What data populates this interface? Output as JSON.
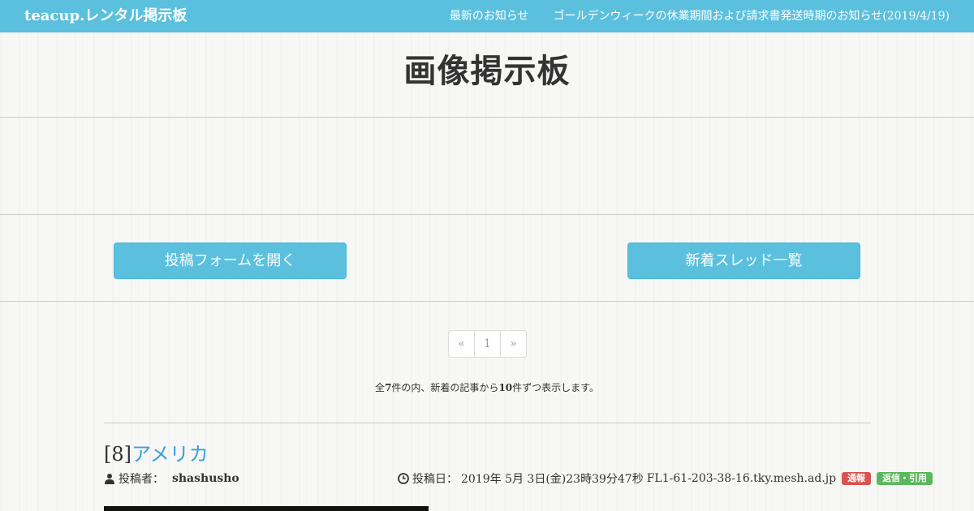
{
  "nav": {
    "brand": "teacup.レンタル掲示板",
    "links": [
      "最新のお知らせ",
      "ゴールデンウィークの休業期間および請求書発送時期のお知らせ(2019/4/19)"
    ]
  },
  "page_title": "画像掲示板",
  "buttons": {
    "open_form": "投稿フォームを開く",
    "new_threads": "新着スレッド一覧"
  },
  "pagination": {
    "prev": "«",
    "current": "1",
    "next": "»"
  },
  "summary": {
    "prefix": "全",
    "total": "7",
    "middle": "件の内、新着の記事から",
    "per_page": "10",
    "suffix": "件ずつ表示します。"
  },
  "post": {
    "number": "[8]",
    "title": "アメリカ",
    "author_label": "投稿者：",
    "author": "shashusho",
    "date_label": "投稿日：",
    "date": "2019年 5月 3日(金)23時39分47秒",
    "host": "FL1-61-203-38-16.tky.mesh.ad.jp",
    "report_badge": "通報",
    "reply_badge": "返信・引用"
  },
  "colors": {
    "accent": "#5bc0de",
    "link": "#3a9fd8",
    "report": "#d9534f",
    "reply": "#5cb85c"
  },
  "icons": {
    "author": "user-icon",
    "date": "clock-icon"
  }
}
